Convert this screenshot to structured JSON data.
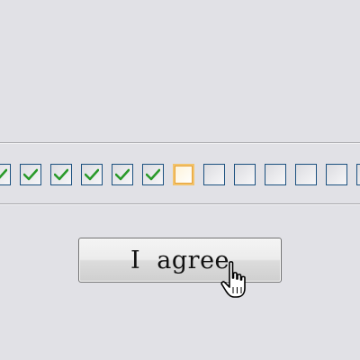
{
  "button": {
    "label": "I  agree"
  },
  "checkboxes": [
    {
      "checked": true
    },
    {
      "checked": true
    },
    {
      "checked": true
    },
    {
      "checked": true
    },
    {
      "checked": true
    },
    {
      "checked": true
    },
    {
      "checked": false,
      "focused": true
    },
    {
      "checked": false
    },
    {
      "checked": false
    },
    {
      "checked": false
    },
    {
      "checked": false
    },
    {
      "checked": false
    },
    {
      "checked": false
    }
  ],
  "colors": {
    "background": "#e1e1e6",
    "checkbox_border": "#1c5180",
    "checkmark": "#2a9a2a",
    "focus_ring": "#f2c36b"
  },
  "icons": {
    "checkmark": "checkmark-icon",
    "cursor": "hand-pointer-icon"
  }
}
